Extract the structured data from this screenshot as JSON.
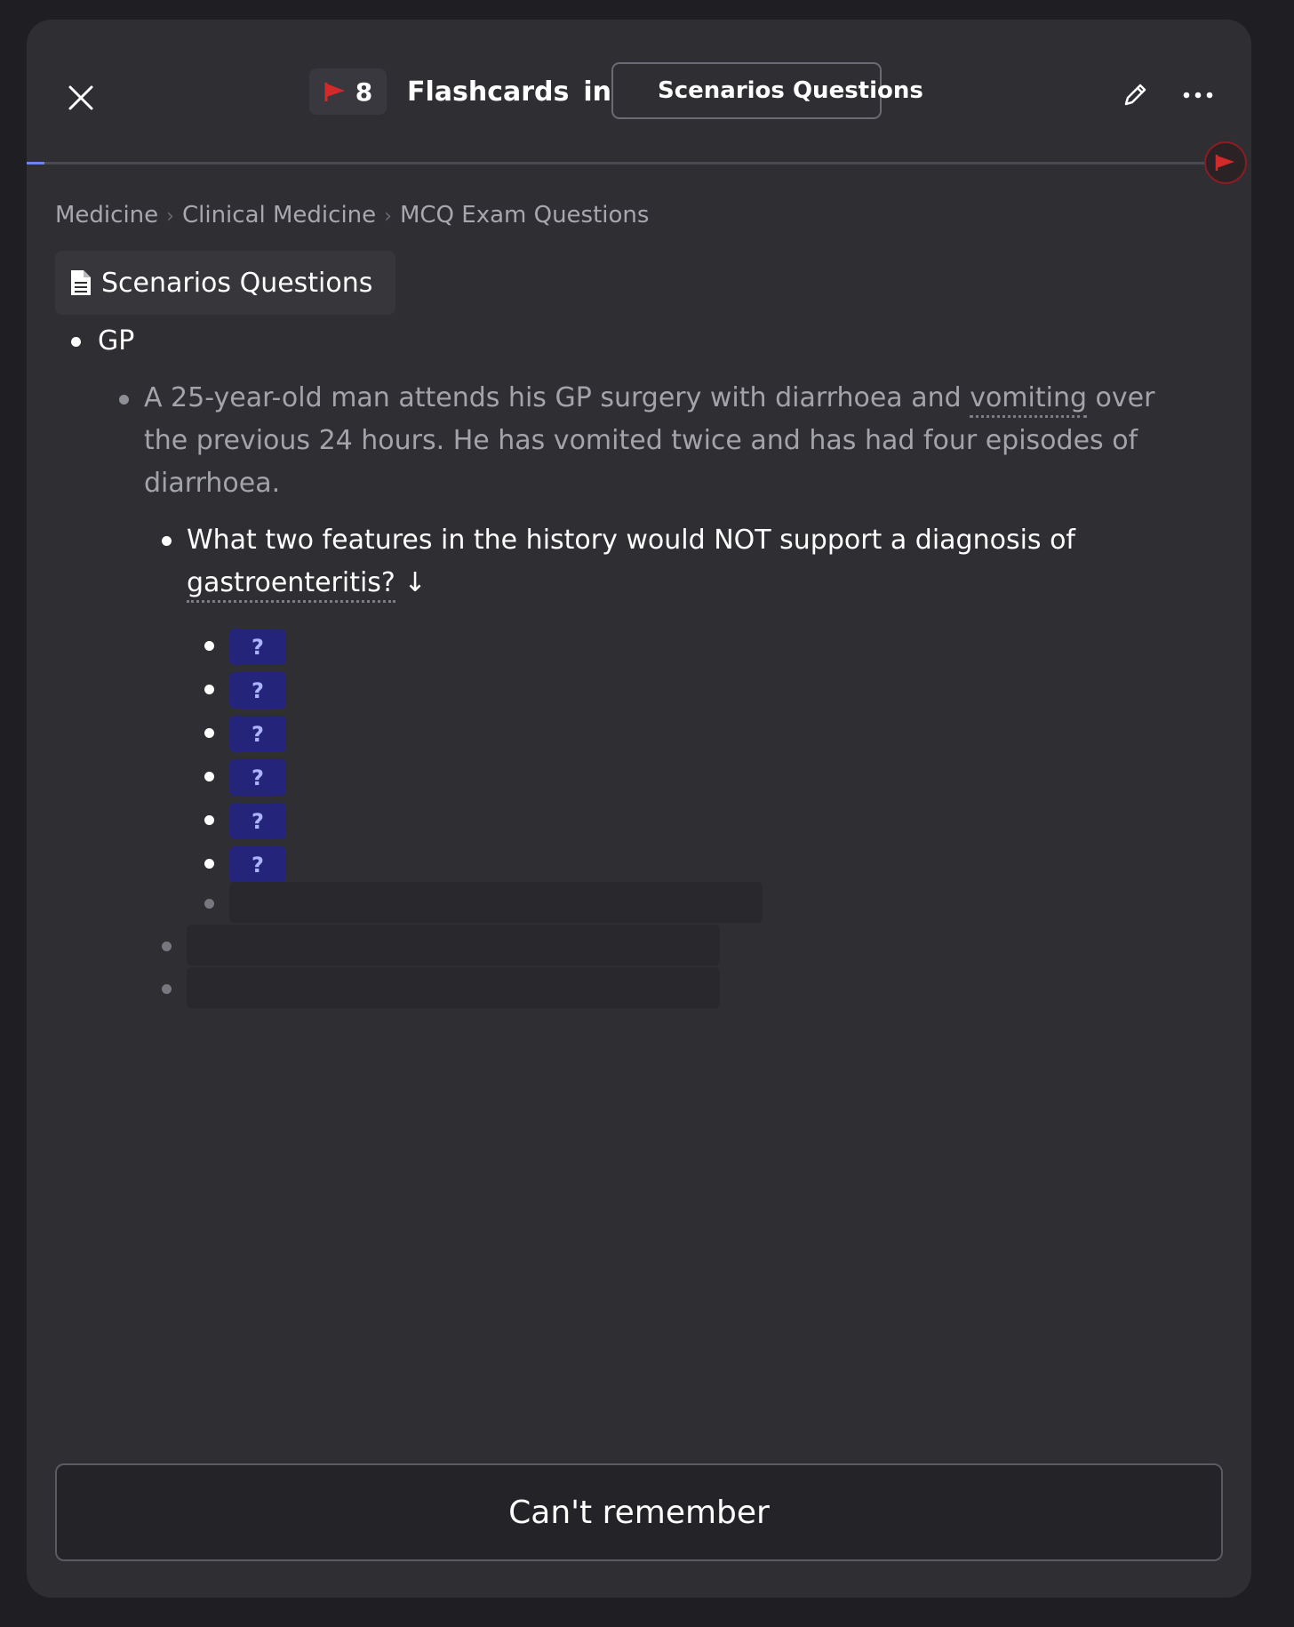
{
  "header": {
    "flag_count": "8",
    "title_word": "Flashcards",
    "title_in": "in",
    "deck_label": "Scenarios Questions"
  },
  "progress": {
    "fraction": 0.015
  },
  "breadcrumb": [
    "Medicine",
    "Clinical Medicine",
    "MCQ Exam Questions"
  ],
  "document": {
    "title": "Scenarios Questions"
  },
  "outline": {
    "root": "GP",
    "scenario_lines": [
      "A 25-year-old man attends his GP surgery with diarrhoea and ",
      "the previous 24 hours. He has vomited twice and has had four episodes of",
      "diarrhoea."
    ],
    "scenario_link": "vomiting",
    "scenario_after_link": " over",
    "question_line1": "What two features in the history would NOT support a diagnosis of",
    "question_link": "gastroenteritis?",
    "question_arrow": "↓",
    "cloze_label": "?",
    "cloze_count": 6
  },
  "footer": {
    "cant_remember": "Can't remember"
  },
  "colors": {
    "background": "#1f1f23",
    "panel": "#2e2e33",
    "accent": "#6a86e8",
    "flag": "#d22a2a",
    "cloze": "#24247a"
  },
  "icons": {
    "close": "close-icon",
    "flag": "flag-icon",
    "deck": "cards-icon",
    "edit": "pencil-icon",
    "more": "more-horizontal-icon",
    "document": "document-icon"
  }
}
